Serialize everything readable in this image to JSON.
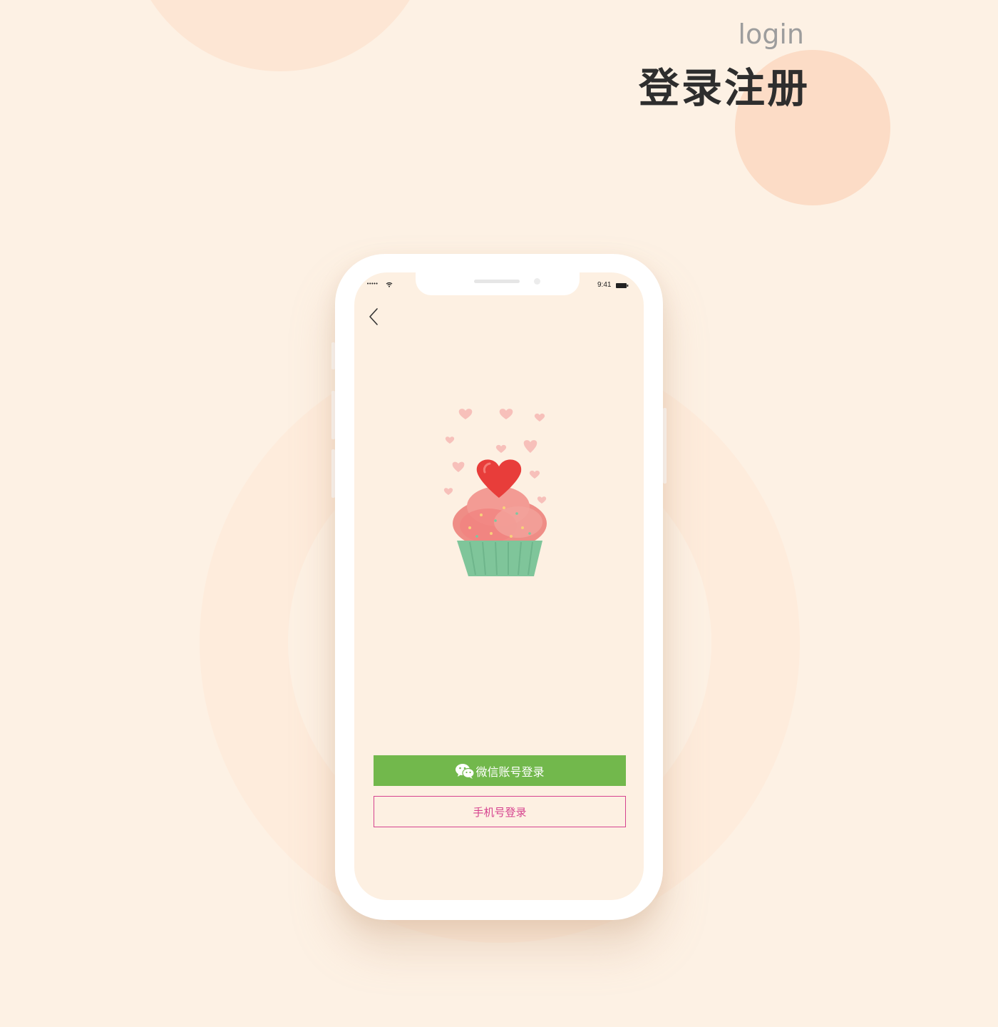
{
  "header": {
    "title_en": "login",
    "title_cn": "登录注册"
  },
  "status_bar": {
    "signal": "•••••",
    "time": "9:41"
  },
  "screen": {
    "back_icon": "chevron-left-icon",
    "illustration": "cupcake-heart-illustration",
    "wechat_button": {
      "label": "微信账号登录",
      "icon": "wechat-icon",
      "color": "#72b84c"
    },
    "phone_button": {
      "label": "手机号登录",
      "color": "#d6438f"
    }
  },
  "colors": {
    "background": "#fdf1e4",
    "accent_circle": "#fcdcc6",
    "title": "#2e2e2e",
    "subtitle": "#9d9d9d"
  }
}
